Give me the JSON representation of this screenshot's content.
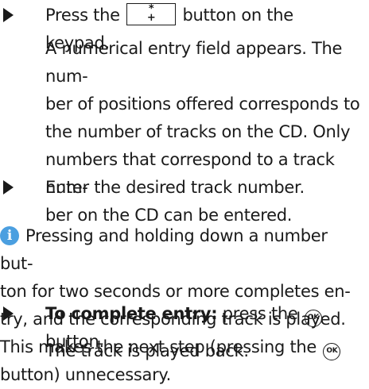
{
  "step1": {
    "before": "Press the",
    "key_symbol_top": "*",
    "key_symbol_bottom": "+",
    "after": "button on the keypad."
  },
  "para1": {
    "lines": [
      "A numerical entry field appears. The num-",
      "ber of positions offered corresponds to",
      "the number of tracks on the CD. Only",
      "numbers that correspond to a track num-",
      "ber on the CD can be entered."
    ]
  },
  "step2": {
    "text": "Enter the desired track number."
  },
  "info": {
    "icon_glyph": "i",
    "line1": "Pressing and holding down a number but-",
    "line2": "ton for two seconds or more completes en-",
    "line3": "try, and the corresponding track is played.",
    "line4_before": "This makes the next step (pressing the",
    "ok_label": "OK",
    "line5": "button) unnecessary."
  },
  "step3": {
    "bold": "To complete entry:",
    "before": "press the",
    "ok_label": "OK",
    "after": "button."
  },
  "para2": {
    "text": "The track is played back."
  },
  "colors": {
    "info_icon": "#4b9fe0",
    "text": "#1a1a1a"
  }
}
